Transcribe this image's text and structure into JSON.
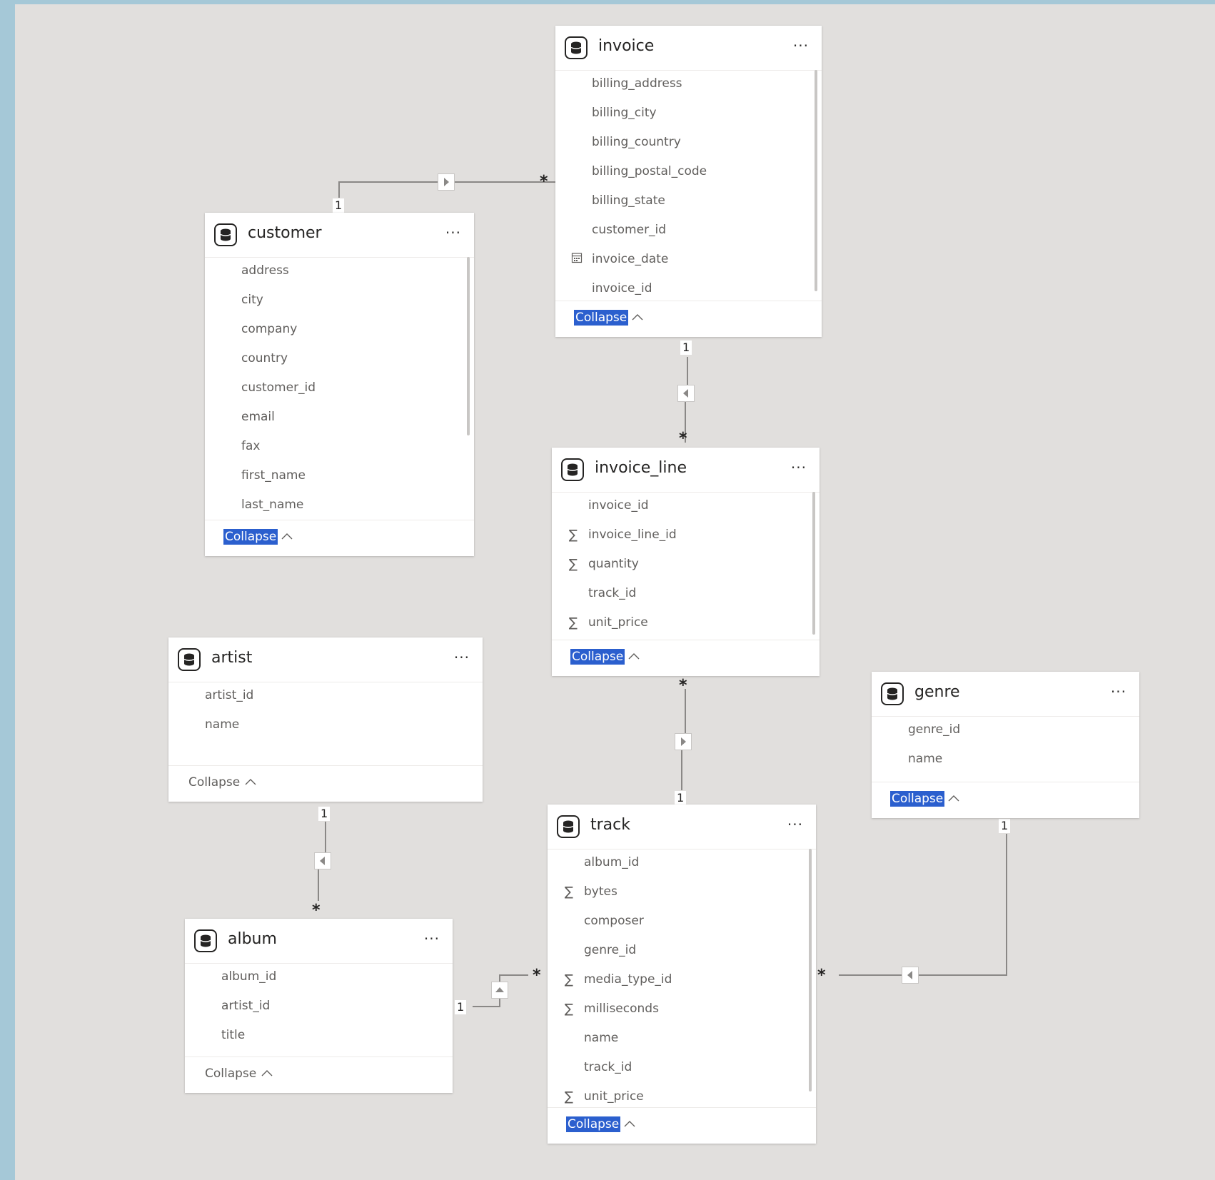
{
  "tables": {
    "invoice": {
      "title": "invoice",
      "fields": [
        {
          "name": "billing_address",
          "icon": ""
        },
        {
          "name": "billing_city",
          "icon": ""
        },
        {
          "name": "billing_country",
          "icon": ""
        },
        {
          "name": "billing_postal_code",
          "icon": ""
        },
        {
          "name": "billing_state",
          "icon": ""
        },
        {
          "name": "customer_id",
          "icon": ""
        },
        {
          "name": "invoice_date",
          "icon": "calendar-icon"
        },
        {
          "name": "invoice_id",
          "icon": ""
        }
      ],
      "collapse_label": "Collapse",
      "collapse_selected": true
    },
    "customer": {
      "title": "customer",
      "fields": [
        {
          "name": "address",
          "icon": ""
        },
        {
          "name": "city",
          "icon": ""
        },
        {
          "name": "company",
          "icon": ""
        },
        {
          "name": "country",
          "icon": ""
        },
        {
          "name": "customer_id",
          "icon": ""
        },
        {
          "name": "email",
          "icon": ""
        },
        {
          "name": "fax",
          "icon": ""
        },
        {
          "name": "first_name",
          "icon": ""
        },
        {
          "name": "last_name",
          "icon": ""
        }
      ],
      "collapse_label": "Collapse",
      "collapse_selected": true
    },
    "invoice_line": {
      "title": "invoice_line",
      "fields": [
        {
          "name": "invoice_id",
          "icon": ""
        },
        {
          "name": "invoice_line_id",
          "icon": "sigma-icon"
        },
        {
          "name": "quantity",
          "icon": "sigma-icon"
        },
        {
          "name": "track_id",
          "icon": ""
        },
        {
          "name": "unit_price",
          "icon": "sigma-icon"
        }
      ],
      "collapse_label": "Collapse",
      "collapse_selected": true
    },
    "artist": {
      "title": "artist",
      "fields": [
        {
          "name": "artist_id",
          "icon": ""
        },
        {
          "name": "name",
          "icon": ""
        }
      ],
      "collapse_label": "Collapse",
      "collapse_selected": false
    },
    "genre": {
      "title": "genre",
      "fields": [
        {
          "name": "genre_id",
          "icon": ""
        },
        {
          "name": "name",
          "icon": ""
        }
      ],
      "collapse_label": "Collapse",
      "collapse_selected": true
    },
    "track": {
      "title": "track",
      "fields": [
        {
          "name": "album_id",
          "icon": ""
        },
        {
          "name": "bytes",
          "icon": "sigma-icon"
        },
        {
          "name": "composer",
          "icon": ""
        },
        {
          "name": "genre_id",
          "icon": ""
        },
        {
          "name": "media_type_id",
          "icon": "sigma-icon"
        },
        {
          "name": "milliseconds",
          "icon": "sigma-icon"
        },
        {
          "name": "name",
          "icon": ""
        },
        {
          "name": "track_id",
          "icon": ""
        },
        {
          "name": "unit_price",
          "icon": "sigma-icon"
        }
      ],
      "collapse_label": "Collapse",
      "collapse_selected": true
    },
    "album": {
      "title": "album",
      "fields": [
        {
          "name": "album_id",
          "icon": ""
        },
        {
          "name": "artist_id",
          "icon": ""
        },
        {
          "name": "title",
          "icon": ""
        }
      ],
      "collapse_label": "Collapse",
      "collapse_selected": false
    }
  },
  "icons": {
    "more": "···",
    "sigma": "∑",
    "chevron_up": "︿"
  },
  "relationships": [
    {
      "from": "customer",
      "to": "invoice",
      "one": "1",
      "many": "*"
    },
    {
      "from": "invoice",
      "to": "invoice_line",
      "one": "1",
      "many": "*"
    },
    {
      "from": "track",
      "to": "invoice_line",
      "one": "1",
      "many": "*"
    },
    {
      "from": "artist",
      "to": "album",
      "one": "1",
      "many": "*"
    },
    {
      "from": "album",
      "to": "track",
      "one": "1",
      "many": "*"
    },
    {
      "from": "genre",
      "to": "track",
      "one": "1",
      "many": "*"
    }
  ]
}
